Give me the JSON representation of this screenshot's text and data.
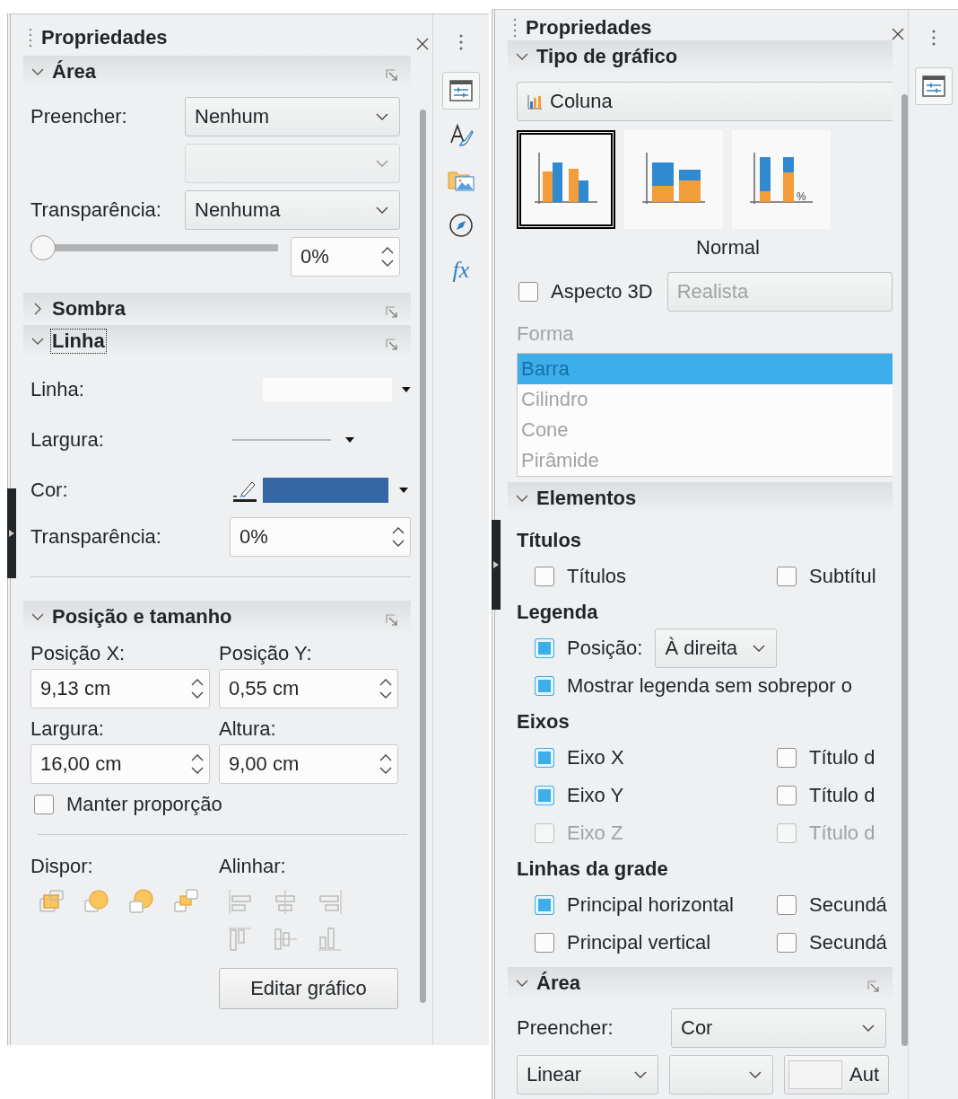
{
  "left_panel": {
    "title": "Propriedades",
    "side_tabs": [
      {
        "kind": "properties",
        "selected": true
      },
      {
        "kind": "styles",
        "selected": false
      },
      {
        "kind": "gallery",
        "selected": false
      },
      {
        "kind": "navigator",
        "selected": false
      },
      {
        "kind": "functions",
        "selected": false,
        "glyph": "fx"
      }
    ],
    "sections": [
      {
        "kind": "area",
        "title": "Área",
        "expanded": true,
        "focused": false,
        "more_options": true,
        "fill_label": "Preencher:",
        "fill_value": "Nenhum",
        "fill_detail_disabled": true,
        "transparency_label": "Transparência:",
        "transparency_value": "Nenhuma",
        "slider": {
          "level": 0
        },
        "percent": "0%"
      },
      {
        "kind": "shadow",
        "title": "Sombra",
        "expanded": false,
        "focused": false,
        "more_options": true
      },
      {
        "kind": "line",
        "title": "Linha",
        "expanded": true,
        "focused": true,
        "more_options": true,
        "line_label": "Linha:",
        "width_label": "Largura:",
        "color_label": "Cor:",
        "color": "#3465a4",
        "transparency_label": "Transparência:",
        "transparency_value": "0%"
      },
      {
        "kind": "position",
        "title": "Posição e tamanho",
        "expanded": true,
        "focused": false,
        "more_options": true,
        "fields": [
          {
            "label": "Posição X:",
            "value": "9,13 cm"
          },
          {
            "label": "Posição Y:",
            "value": "0,55 cm"
          },
          {
            "label": "Largura:",
            "value": "16,00 cm"
          },
          {
            "label": "Altura:",
            "value": "9,00 cm"
          }
        ],
        "keep_ratio": {
          "label": "Manter proporção",
          "checked": false
        },
        "arrange_label": "Dispor:",
        "align_label": "Alinhar:",
        "edit_button": "Editar gráfico"
      }
    ]
  },
  "right_panel": {
    "title": "Propriedades",
    "side_tabs": [
      {
        "kind": "properties",
        "selected": true
      }
    ],
    "sections": [
      {
        "kind": "chart_type",
        "title": "Tipo de gráfico",
        "expanded": true,
        "focused": false,
        "more_options": false,
        "type_value": "Coluna",
        "variants": [
          {
            "kind": "normal",
            "selected": true
          },
          {
            "kind": "stacked",
            "selected": false
          },
          {
            "kind": "percent",
            "selected": false,
            "badge": "%"
          }
        ],
        "variant_label": "Normal",
        "three_d": {
          "label": "Aspecto 3D",
          "checked": false
        },
        "scheme": {
          "value": "Realista",
          "disabled": true
        },
        "shape_label": "Forma",
        "shapes_disabled": true,
        "shapes": [
          {
            "label": "Barra",
            "selected": true
          },
          {
            "label": "Cilindro",
            "selected": false
          },
          {
            "label": "Cone",
            "selected": false
          },
          {
            "label": "Pirâmide",
            "selected": false
          }
        ]
      },
      {
        "kind": "elements",
        "title": "Elementos",
        "expanded": true,
        "focused": false,
        "more_options": false,
        "groups": [
          {
            "heading": "Títulos",
            "rows": [
              {
                "kind": "checks",
                "items": [
                  {
                    "label": "Títulos",
                    "checked": false,
                    "disabled": false
                  },
                  {
                    "label": "Subtítul",
                    "checked": false,
                    "disabled": false
                  }
                ]
              }
            ]
          },
          {
            "heading": "Legenda",
            "rows": [
              {
                "kind": "check_select",
                "label": "Posição:",
                "checked": true,
                "value": "À direita"
              },
              {
                "kind": "checks",
                "items": [
                  {
                    "label": "Mostrar legenda sem sobrepor o",
                    "checked": true,
                    "disabled": false
                  }
                ]
              }
            ]
          },
          {
            "heading": "Eixos",
            "rows": [
              {
                "kind": "checks",
                "items": [
                  {
                    "label": "Eixo X",
                    "checked": true,
                    "disabled": false
                  },
                  {
                    "label": "Título d",
                    "checked": false,
                    "disabled": false
                  }
                ]
              },
              {
                "kind": "checks",
                "items": [
                  {
                    "label": "Eixo Y",
                    "checked": true,
                    "disabled": false
                  },
                  {
                    "label": "Título d",
                    "checked": false,
                    "disabled": false
                  }
                ]
              },
              {
                "kind": "checks",
                "items": [
                  {
                    "label": "Eixo Z",
                    "checked": false,
                    "disabled": true
                  },
                  {
                    "label": "Título d",
                    "checked": false,
                    "disabled": true
                  }
                ]
              }
            ]
          },
          {
            "heading": "Linhas da grade",
            "rows": [
              {
                "kind": "checks",
                "items": [
                  {
                    "label": "Principal horizontal",
                    "checked": true,
                    "disabled": false
                  },
                  {
                    "label": "Secundá",
                    "checked": false,
                    "disabled": false
                  }
                ]
              },
              {
                "kind": "checks",
                "items": [
                  {
                    "label": "Principal vertical",
                    "checked": false,
                    "disabled": false
                  },
                  {
                    "label": "Secundá",
                    "checked": false,
                    "disabled": false
                  }
                ]
              }
            ]
          }
        ]
      },
      {
        "kind": "fill",
        "title": "Área",
        "expanded": true,
        "focused": false,
        "more_options": true,
        "fill_label": "Preencher:",
        "fill_value": "Cor",
        "gradient": {
          "style": "Linear",
          "auto": "Aut"
        }
      }
    ]
  }
}
